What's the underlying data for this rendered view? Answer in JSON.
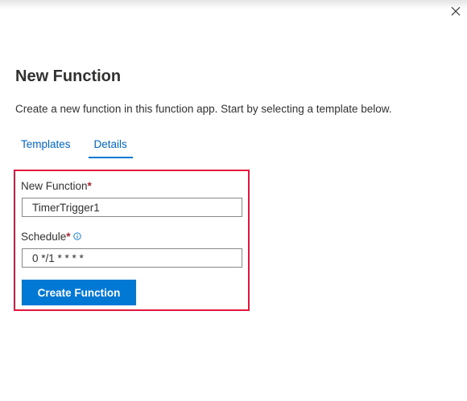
{
  "panel": {
    "title": "New Function",
    "description": "Create a new function in this function app. Start by selecting a template below.",
    "close_icon": "close-icon"
  },
  "tabs": [
    {
      "label": "Templates",
      "active": false
    },
    {
      "label": "Details",
      "active": true
    }
  ],
  "form": {
    "name_field": {
      "label": "New Function",
      "required_marker": "*",
      "value": "TimerTrigger1"
    },
    "schedule_field": {
      "label": "Schedule",
      "required_marker": "*",
      "info_icon": "info-icon",
      "value": "0 */1 * * * *"
    },
    "submit_label": "Create Function"
  },
  "colors": {
    "accent": "#0078d4",
    "link": "#0066cc",
    "highlight_border": "#e3173e",
    "required": "#a4262c"
  }
}
